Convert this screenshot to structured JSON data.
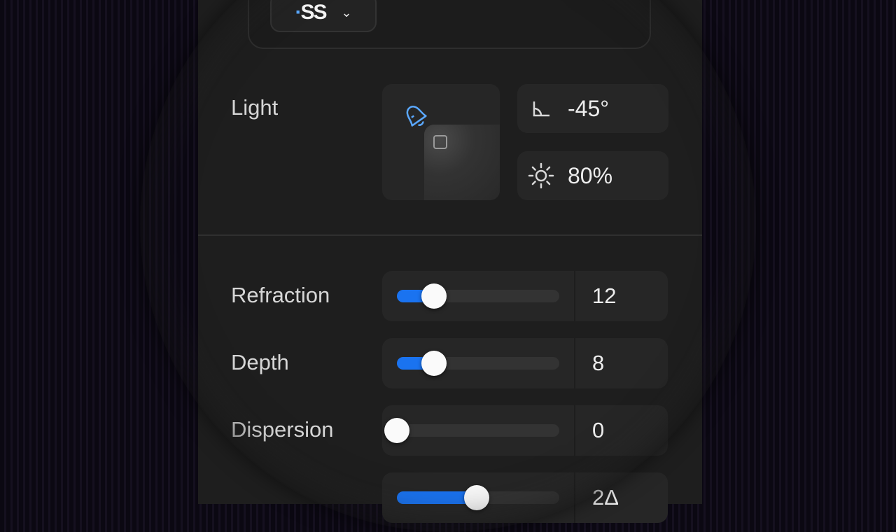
{
  "header": {
    "font_logo": "SS",
    "font_logo_accent": "·"
  },
  "light": {
    "label": "Light",
    "angle": "-45°",
    "intensity": "80%"
  },
  "sliders": [
    {
      "label": "Refraction",
      "value": "12",
      "fraction": 0.23
    },
    {
      "label": "Depth",
      "value": "8",
      "fraction": 0.23
    },
    {
      "label": "Dispersion",
      "value": "0",
      "fraction": 0.0
    },
    {
      "label": "",
      "value": "2Δ",
      "fraction": 0.49
    }
  ],
  "colors": {
    "accent": "#1a73f0",
    "panel": "#1e1e1e",
    "field": "#262626"
  }
}
